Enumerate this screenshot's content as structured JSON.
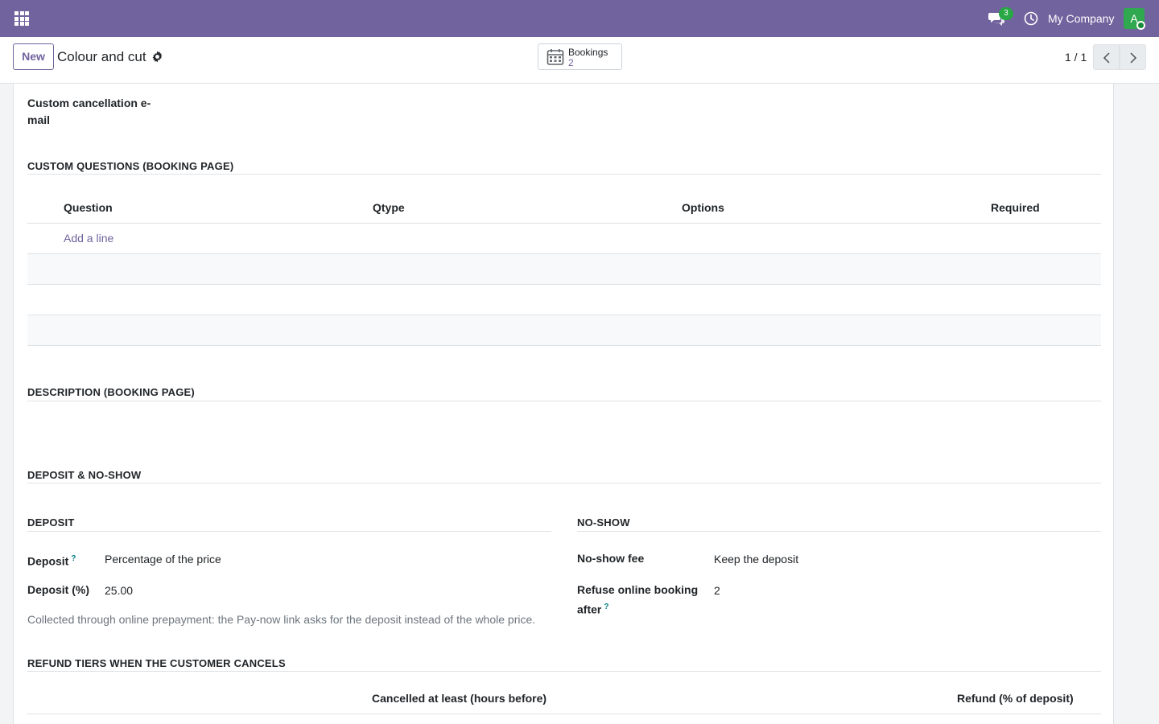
{
  "navbar": {
    "apps_icon": "grid-icon",
    "chat_icon": "chat-icon",
    "chat_count": "3",
    "activity_icon": "clock-icon",
    "company": "My Company",
    "avatar_letter": "A",
    "colors": {
      "brand": "#71639e",
      "avatar": "#2fa84f",
      "badge": "#28a745"
    }
  },
  "control": {
    "new_label": "New",
    "record_title": "Colour and cut",
    "gear_icon": "gear-icon",
    "smart_button": {
      "icon": "calendar-icon",
      "label": "Bookings",
      "value": "2"
    },
    "pager": "1 / 1"
  },
  "form": {
    "custom_cancel_label": "Custom cancellation e-mail",
    "questions": {
      "title": "CUSTOM QUESTIONS (BOOKING PAGE)",
      "columns": [
        "Question",
        "Qtype",
        "Options",
        "Required"
      ],
      "add_line": "Add a line"
    },
    "description_title": "DESCRIPTION (BOOKING PAGE)",
    "deposit_noshow_title": "DEPOSIT & NO-SHOW",
    "deposit": {
      "title": "DEPOSIT",
      "deposit_label": "Deposit",
      "deposit_help": "?",
      "deposit_value": "Percentage of the price",
      "percent_label": "Deposit (%)",
      "percent_value": "25.00",
      "note": "Collected through online prepayment: the Pay-now link asks for the deposit instead of the whole price."
    },
    "noshow": {
      "title": "NO-SHOW",
      "fee_label": "No-show fee",
      "fee_value": "Keep the deposit",
      "refuse_label": "Refuse online booking after",
      "refuse_help": "?",
      "refuse_value": "2"
    },
    "refund": {
      "title": "REFUND TIERS WHEN THE CUSTOMER CANCELS",
      "columns": [
        "Cancelled at least (hours before)",
        "Refund (% of deposit)"
      ]
    }
  }
}
